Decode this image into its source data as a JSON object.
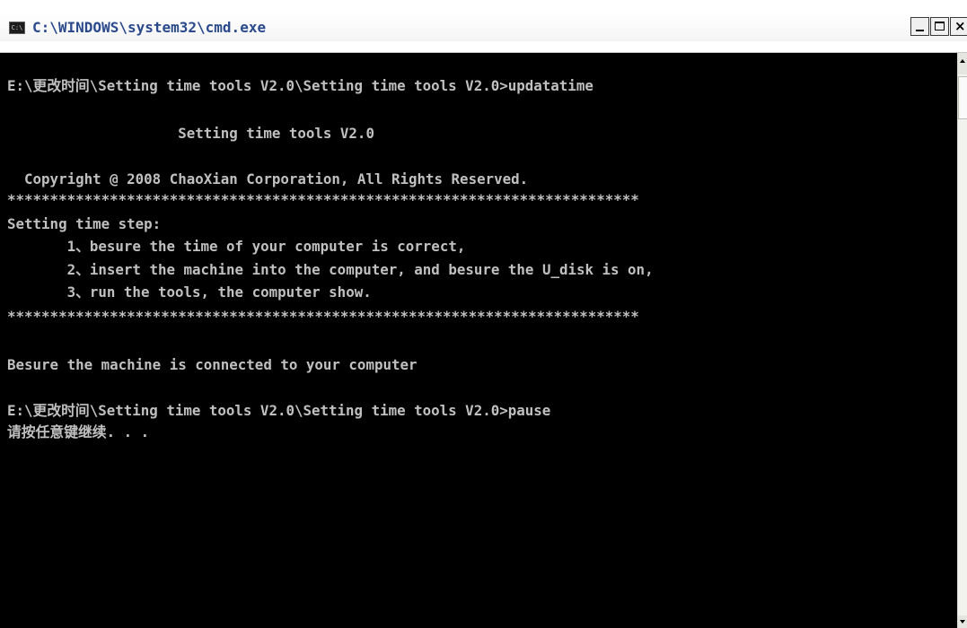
{
  "window": {
    "title": "C:\\WINDOWS\\system32\\cmd.exe",
    "icon_label": "C:\\",
    "controls": {
      "minimize_icon": "minimize-icon",
      "maximize_icon": "maximize-icon",
      "close_icon": "close-icon",
      "close_glyph": "×"
    }
  },
  "colors": {
    "console_background": "#000000",
    "console_text": "#c0c0c0",
    "title_text": "#2a4a8c"
  },
  "console": {
    "lines": [
      "",
      "E:\\更改时间\\Setting time tools V2.0\\Setting time tools V2.0>updatatime",
      "",
      "                    Setting time tools V2.0",
      "",
      "  Copyright @ 2008 ChaoXian Corporation, All Rights Reserved.",
      "**************************************************************************",
      "Setting time step:",
      "       1、besure the time of your computer is correct,",
      "       2、insert the machine into the computer, and besure the U_disk is on,",
      "       3、run the tools, the computer show.",
      "**************************************************************************",
      "",
      "Besure the machine is connected to your computer",
      "",
      "E:\\更改时间\\Setting time tools V2.0\\Setting time tools V2.0>pause",
      "请按任意键继续. . ."
    ]
  }
}
